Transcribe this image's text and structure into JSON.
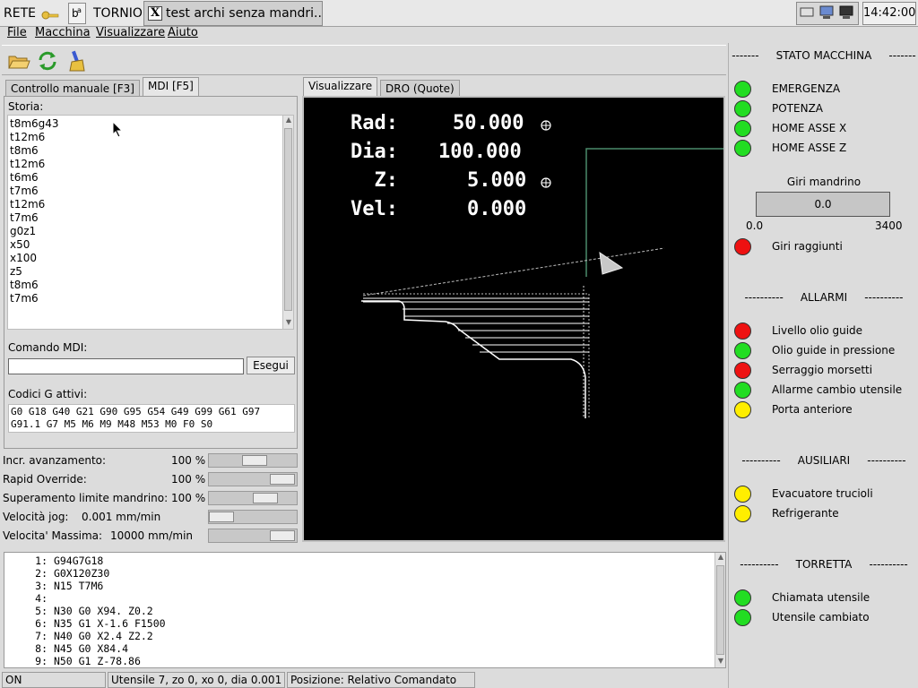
{
  "taskbar": {
    "start_label": "RETE",
    "app_label": "TORNIO",
    "window_title": "test archi senza mandri...",
    "clock": "14:42:00"
  },
  "menu": [
    "File",
    "Macchina",
    "Visualizzare",
    "Aiuto"
  ],
  "tabs": {
    "manual": "Controllo manuale [F3]",
    "mdi": "MDI [F5]",
    "visual": "Visualizzare",
    "dro": "DRO (Quote)"
  },
  "mdi": {
    "history_label": "Storia:",
    "history": [
      "t8m6g43",
      "t12m6",
      "t8m6",
      "t12m6",
      "t6m6",
      "t7m6",
      "t12m6",
      "t7m6",
      "g0z1",
      "x50",
      "x100",
      "z5",
      "t8m6",
      "t7m6"
    ],
    "command_label": "Comando MDI:",
    "command_value": "",
    "exec_label": "Esegui",
    "gcodes_label": "Codici G attivi:",
    "gcodes_line1": "G0 G18 G40 G21 G90 G95 G54 G49 G99 G61 G97",
    "gcodes_line2": "G91.1 G7 M5 M6 M9 M48 M53 M0 F0 S0"
  },
  "overrides": [
    {
      "label": "Incr. avanzamento:",
      "value": "100 %",
      "level": 0.55
    },
    {
      "label": "Rapid Override:",
      "value": "100 %",
      "level": 1.0
    },
    {
      "label": "Superamento limite mandrino:",
      "value": "100 %",
      "level": 0.72
    },
    {
      "label": "Velocità jog:",
      "value": "0.001 mm/min",
      "level": 0.0
    },
    {
      "label": "Velocita' Massima:",
      "value": "10000 mm/min",
      "level": 1.0
    }
  ],
  "dro": [
    {
      "label": "Rad:",
      "value": "50.000",
      "marker": true
    },
    {
      "label": "Dia:",
      "value": "100.000",
      "marker": false
    },
    {
      "label": "  Z:",
      "value": "5.000",
      "marker": true
    },
    {
      "label": "Vel:",
      "value": "0.000",
      "marker": false
    }
  ],
  "program": [
    {
      "n": "1:",
      "code": "G94G7G18"
    },
    {
      "n": "2:",
      "code": "G0X120Z30"
    },
    {
      "n": "3:",
      "code": "N15 T7M6"
    },
    {
      "n": "4:",
      "code": ""
    },
    {
      "n": "5:",
      "code": "N30 G0 X94. Z0.2"
    },
    {
      "n": "6:",
      "code": "N35 G1 X-1.6 F1500"
    },
    {
      "n": "7:",
      "code": "N40 G0 X2.4 Z2.2"
    },
    {
      "n": "8:",
      "code": "N45 G0 X84.4"
    },
    {
      "n": "9:",
      "code": "N50 G1 Z-78.86"
    }
  ],
  "status": {
    "state": "ON",
    "tool": "Utensile 7, zo 0, xo 0, dia 0.001",
    "position": "Posizione: Relativo Comandato"
  },
  "right": {
    "machine_header": "-------     STATO MACCHINA     -------",
    "machine": [
      {
        "label": "EMERGENZA",
        "color": "#22dd22"
      },
      {
        "label": "POTENZA",
        "color": "#22dd22"
      },
      {
        "label": "HOME ASSE X",
        "color": "#22dd22"
      },
      {
        "label": "HOME ASSE Z",
        "color": "#22dd22"
      }
    ],
    "spindle_label": "Giri mandrino",
    "spindle_value": "0.0",
    "spindle_min": "0.0",
    "spindle_max": "3400",
    "speed_reached": {
      "label": "Giri raggiunti",
      "color": "#ee1111"
    },
    "alarm_header": "----------     ALLARMI     ----------",
    "alarms": [
      {
        "label": "Livello olio guide",
        "color": "#ee1111"
      },
      {
        "label": "Olio guide in pressione",
        "color": "#22dd22"
      },
      {
        "label": "Serraggio morsetti",
        "color": "#ee1111"
      },
      {
        "label": "Allarme cambio utensile",
        "color": "#22dd22"
      },
      {
        "label": "Porta anteriore",
        "color": "#ffee00"
      }
    ],
    "aux_header": "----------     AUSILIARI     ----------",
    "aux": [
      {
        "label": "Evacuatore trucioli",
        "color": "#ffee00"
      },
      {
        "label": "Refrigerante",
        "color": "#ffee00"
      }
    ],
    "turret_header": "----------     TORRETTA     ----------",
    "turret": [
      {
        "label": "Chiamata utensile",
        "color": "#22dd22"
      },
      {
        "label": "Utensile cambiato",
        "color": "#22dd22"
      }
    ]
  }
}
